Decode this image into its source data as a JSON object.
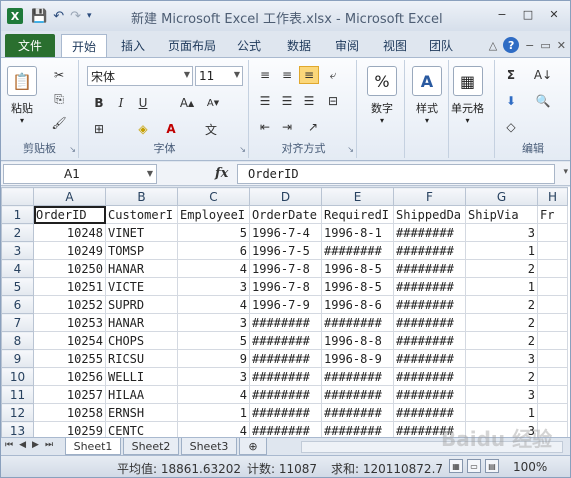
{
  "window": {
    "title": "新建 Microsoft Excel 工作表.xlsx  -  Microsoft Excel",
    "app_icon_letter": "X",
    "controls": [
      "−",
      "□",
      "✕"
    ]
  },
  "ribbon_tabs": [
    "文件",
    "开始",
    "插入",
    "页面布局",
    "公式",
    "数据",
    "审阅",
    "视图",
    "团队"
  ],
  "ribbon": {
    "clipboard": {
      "label": "剪贴板",
      "paste": "粘贴"
    },
    "font": {
      "label": "字体",
      "font_name": "宋体",
      "font_size": "11"
    },
    "alignment": {
      "label": "对齐方式"
    },
    "number": {
      "label": "数字"
    },
    "styles": {
      "label": "样式"
    },
    "cells": {
      "label": "单元格"
    },
    "editing": {
      "label": "编辑"
    }
  },
  "formula_bar": {
    "name_box": "A1",
    "fx": "fx",
    "content": "OrderID"
  },
  "columns": [
    "A",
    "B",
    "C",
    "D",
    "E",
    "F",
    "G",
    "H"
  ],
  "header_row": [
    "OrderID",
    "CustomerI",
    "EmployeeI",
    "OrderDate",
    "RequiredI",
    "ShippedDa",
    "ShipVia",
    "Fr"
  ],
  "rows": [
    [
      "10248",
      "VINET",
      "5",
      "1996-7-4",
      "1996-8-1",
      "########",
      "3"
    ],
    [
      "10249",
      "TOMSP",
      "6",
      "1996-7-5",
      "########",
      "########",
      "1"
    ],
    [
      "10250",
      "HANAR",
      "4",
      "1996-7-8",
      "1996-8-5",
      "########",
      "2"
    ],
    [
      "10251",
      "VICTE",
      "3",
      "1996-7-8",
      "1996-8-5",
      "########",
      "1"
    ],
    [
      "10252",
      "SUPRD",
      "4",
      "1996-7-9",
      "1996-8-6",
      "########",
      "2"
    ],
    [
      "10253",
      "HANAR",
      "3",
      "########",
      "########",
      "########",
      "2"
    ],
    [
      "10254",
      "CHOPS",
      "5",
      "########",
      "1996-8-8",
      "########",
      "2"
    ],
    [
      "10255",
      "RICSU",
      "9",
      "########",
      "1996-8-9",
      "########",
      "3"
    ],
    [
      "10256",
      "WELLI",
      "3",
      "########",
      "########",
      "########",
      "2"
    ],
    [
      "10257",
      "HILAA",
      "4",
      "########",
      "########",
      "########",
      "3"
    ],
    [
      "10258",
      "ERNSH",
      "1",
      "########",
      "########",
      "########",
      "1"
    ],
    [
      "10259",
      "CENTC",
      "4",
      "########",
      "########",
      "########",
      "3"
    ]
  ],
  "sheets": [
    "Sheet1",
    "Sheet2",
    "Sheet3"
  ],
  "status": {
    "average": "平均值: 18861.63202",
    "count": "计数: 11087",
    "sum": "求和: 120110872.7",
    "zoom": "100%"
  },
  "watermark": "Baidu 经验"
}
